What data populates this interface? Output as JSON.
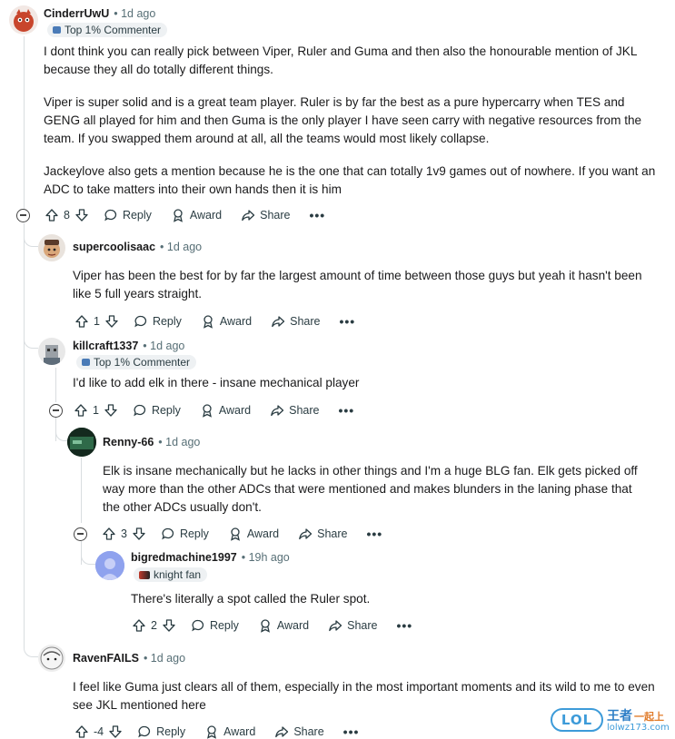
{
  "comments": [
    {
      "author": "CinderrUwU",
      "time": "• 1d ago",
      "flair": "Top 1% Commenter",
      "paragraphs": [
        "I dont think you can really pick between Viper, Ruler and Guma and then also the honourable mention of JKL because they all do totally different things.",
        "Viper is super solid and is a great team player. Ruler is by far the best as a pure hypercarry when TES and GENG all played for him and then Guma is the only player I have seen carry with negative resources from the team. If you swapped them around at all, all the teams would most likely collapse.",
        "Jackeylove also gets a mention because he is the one that can totally 1v9 games out of nowhere. If you want an ADC to take matters into their own hands then it is him"
      ],
      "score": "8"
    },
    {
      "author": "supercoolisaac",
      "time": "• 1d ago",
      "paragraphs": [
        "Viper has been the best for by far the largest amount of time between those guys but yeah it hasn't been like 5 full years straight."
      ],
      "score": "1"
    },
    {
      "author": "killcraft1337",
      "time": "• 1d ago",
      "flair": "Top 1% Commenter",
      "paragraphs": [
        "I'd like to add elk in there - insane mechanical player"
      ],
      "score": "1"
    },
    {
      "author": "Renny-66",
      "time": "• 1d ago",
      "paragraphs": [
        "Elk is insane mechanically but he lacks in other things and I'm a huge BLG fan. Elk gets picked off way more than the other ADCs that were mentioned and makes blunders in the laning phase that the other ADCs usually don't."
      ],
      "score": "3"
    },
    {
      "author": "bigredmachine1997",
      "time": "• 19h ago",
      "flair": "knight fan",
      "paragraphs": [
        "There's literally a spot called the Ruler spot."
      ],
      "score": "2"
    },
    {
      "author": "RavenFAILS",
      "time": "• 1d ago",
      "paragraphs": [
        "I feel like Guma just clears all of them, especially in the most important moments and its wild to me to even see JKL mentioned here"
      ],
      "score": "-4"
    }
  ],
  "actions": {
    "reply": "Reply",
    "award": "Award",
    "share": "Share",
    "more": "•••"
  },
  "watermark": {
    "logo": "LOL",
    "brand": "王者",
    "slogan": "一起上",
    "url": "lolwz173.com"
  },
  "colors": {
    "accent_blue": "#4a7bb7",
    "thread_line": "#d9dde0",
    "meta_gray": "#576f76"
  }
}
